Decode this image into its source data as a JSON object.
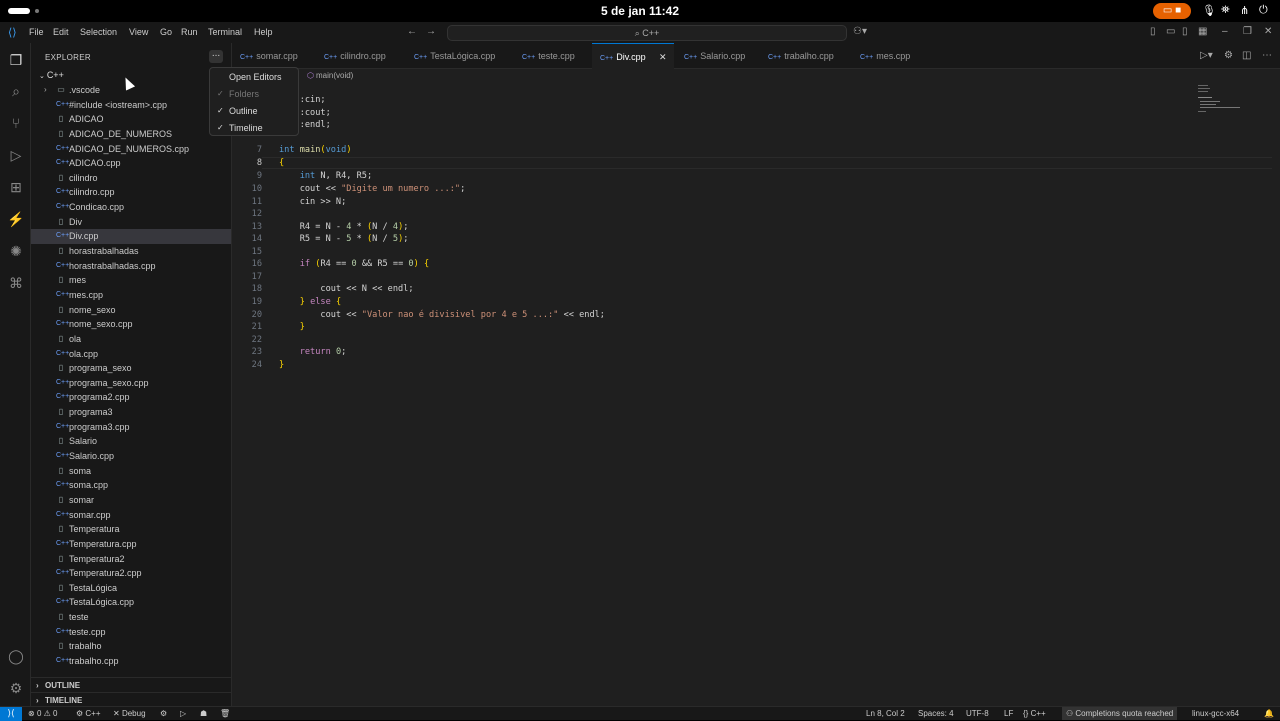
{
  "gnome": {
    "clock": "5 de jan  11:42"
  },
  "menu": {
    "items": [
      "File",
      "Edit",
      "Selection",
      "View",
      "Go",
      "Run",
      "Terminal",
      "Help"
    ]
  },
  "command_center": {
    "label": "C++"
  },
  "sidebar": {
    "title": "EXPLORER",
    "more_label": "...",
    "root": "C++",
    "items": [
      {
        "name": ".vscode",
        "type": "folder"
      },
      {
        "name": "#include <iostream>.cpp",
        "type": "cpp"
      },
      {
        "name": "ADICAO",
        "type": "file"
      },
      {
        "name": "ADICAO_DE_NUMEROS",
        "type": "file"
      },
      {
        "name": "ADICAO_DE_NUMEROS.cpp",
        "type": "cpp"
      },
      {
        "name": "ADICAO.cpp",
        "type": "cpp"
      },
      {
        "name": "cilindro",
        "type": "file"
      },
      {
        "name": "cilindro.cpp",
        "type": "cpp"
      },
      {
        "name": "Condicao.cpp",
        "type": "cpp"
      },
      {
        "name": "Div",
        "type": "file"
      },
      {
        "name": "Div.cpp",
        "type": "cpp",
        "selected": true
      },
      {
        "name": "horastrabalhadas",
        "type": "file"
      },
      {
        "name": "horastrabalhadas.cpp",
        "type": "cpp"
      },
      {
        "name": "mes",
        "type": "file"
      },
      {
        "name": "mes.cpp",
        "type": "cpp"
      },
      {
        "name": "nome_sexo",
        "type": "file"
      },
      {
        "name": "nome_sexo.cpp",
        "type": "cpp"
      },
      {
        "name": "ola",
        "type": "file"
      },
      {
        "name": "ola.cpp",
        "type": "cpp"
      },
      {
        "name": "programa_sexo",
        "type": "file"
      },
      {
        "name": "programa_sexo.cpp",
        "type": "cpp"
      },
      {
        "name": "programa2.cpp",
        "type": "cpp"
      },
      {
        "name": "programa3",
        "type": "file"
      },
      {
        "name": "programa3.cpp",
        "type": "cpp"
      },
      {
        "name": "Salario",
        "type": "file"
      },
      {
        "name": "Salario.cpp",
        "type": "cpp"
      },
      {
        "name": "soma",
        "type": "file"
      },
      {
        "name": "soma.cpp",
        "type": "cpp"
      },
      {
        "name": "somar",
        "type": "file"
      },
      {
        "name": "somar.cpp",
        "type": "cpp"
      },
      {
        "name": "Temperatura",
        "type": "file"
      },
      {
        "name": "Temperatura.cpp",
        "type": "cpp"
      },
      {
        "name": "Temperatura2",
        "type": "file"
      },
      {
        "name": "Temperatura2.cpp",
        "type": "cpp"
      },
      {
        "name": "TestaLógica",
        "type": "file"
      },
      {
        "name": "TestaLógica.cpp",
        "type": "cpp"
      },
      {
        "name": "teste",
        "type": "file"
      },
      {
        "name": "teste.cpp",
        "type": "cpp"
      },
      {
        "name": "trabalho",
        "type": "file"
      },
      {
        "name": "trabalho.cpp",
        "type": "cpp"
      }
    ],
    "sections": {
      "outline": "OUTLINE",
      "timeline": "TIMELINE"
    }
  },
  "dropdown": {
    "items": [
      {
        "label": "Open Editors",
        "checked": false,
        "disabled": false
      },
      {
        "label": "Folders",
        "checked": true,
        "disabled": true
      },
      {
        "label": "Outline",
        "checked": true,
        "disabled": false
      },
      {
        "label": "Timeline",
        "checked": true,
        "disabled": false
      }
    ]
  },
  "tabs": [
    {
      "label": "somar.cpp",
      "active": false
    },
    {
      "label": "cilindro.cpp",
      "active": false
    },
    {
      "label": "TestaLógica.cpp",
      "active": false
    },
    {
      "label": "teste.cpp",
      "active": false
    },
    {
      "label": "Div.cpp",
      "active": true
    },
    {
      "label": "Salario.cpp",
      "active": false
    },
    {
      "label": "trabalho.cpp",
      "active": false
    },
    {
      "label": "mes.cpp",
      "active": false
    }
  ],
  "breadcrumb": {
    "symbol": "main(void)"
  },
  "editor": {
    "current_line": 8,
    "lines": [
      {
        "n": "",
        "code": "std::cin;"
      },
      {
        "n": "",
        "code": "std::cout;"
      },
      {
        "n": "",
        "code": "std::endl;"
      },
      {
        "n": "",
        "code": ""
      },
      {
        "n": "7",
        "code": "int main(void)"
      },
      {
        "n": "8",
        "code": "{"
      },
      {
        "n": "9",
        "code": "    int N, R4, R5;"
      },
      {
        "n": "10",
        "code": "    cout << \"Digite um numero ...:\";"
      },
      {
        "n": "11",
        "code": "    cin >> N;"
      },
      {
        "n": "12",
        "code": ""
      },
      {
        "n": "13",
        "code": "    R4 = N - 4 * (N / 4);"
      },
      {
        "n": "14",
        "code": "    R5 = N - 5 * (N / 5);"
      },
      {
        "n": "15",
        "code": ""
      },
      {
        "n": "16",
        "code": "    if (R4 == 0 && R5 == 0) {"
      },
      {
        "n": "17",
        "code": ""
      },
      {
        "n": "18",
        "code": "        cout << N << endl;"
      },
      {
        "n": "19",
        "code": "    } else {"
      },
      {
        "n": "20",
        "code": "        cout << \"Valor nao é divisivel por 4 e 5 ...:\" << endl;"
      },
      {
        "n": "21",
        "code": "    }"
      },
      {
        "n": "22",
        "code": ""
      },
      {
        "n": "23",
        "code": "    return 0;"
      },
      {
        "n": "24",
        "code": "}"
      }
    ]
  },
  "statusbar": {
    "errors": "0",
    "warnings": "0",
    "lang_config": "C++",
    "debug": "Debug",
    "position": "Ln 8, Col 2",
    "spaces": "Spaces: 4",
    "encoding": "UTF-8",
    "eol": "LF",
    "language": "C++",
    "quota": "Completions quota reached",
    "compiler": "linux-gcc-x64"
  }
}
